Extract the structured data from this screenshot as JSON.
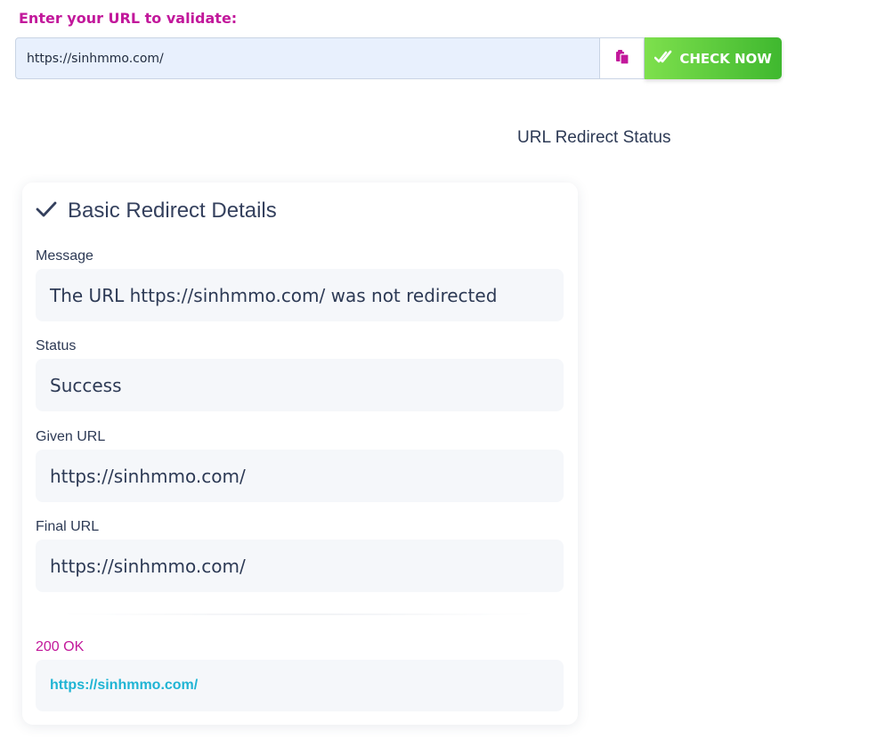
{
  "form": {
    "label": "Enter your URL to validate:",
    "url_value": "https://sinhmmo.com/",
    "paste_icon": "paste-icon",
    "check_label": "CHECK NOW",
    "check_icon": "double-check-icon"
  },
  "section": {
    "title": "URL Redirect Status"
  },
  "details": {
    "title": "Basic Redirect Details",
    "fields": [
      {
        "label": "Message",
        "value": "The URL https://sinhmmo.com/ was not redirected"
      },
      {
        "label": "Status",
        "value": "Success"
      },
      {
        "label": "Given URL",
        "value": "https://sinhmmo.com/"
      },
      {
        "label": "Final URL",
        "value": "https://sinhmmo.com/"
      }
    ],
    "status_code": "200 OK",
    "final_link": "https://sinhmmo.com/"
  },
  "colors": {
    "accent_pink": "#c2189b",
    "button_green": "#3fb82f",
    "link_cyan": "#1fb4d4",
    "input_bg": "#e8f0fd"
  }
}
